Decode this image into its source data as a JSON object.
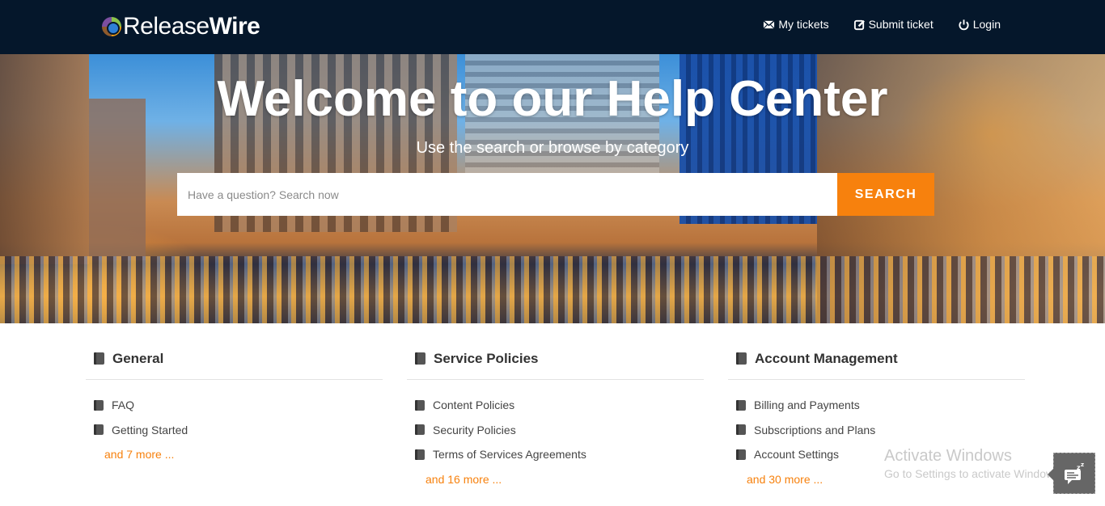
{
  "header": {
    "logo": {
      "light": "Release",
      "bold": "Wire"
    },
    "nav": [
      {
        "label": "My tickets",
        "icon": "envelope-icon"
      },
      {
        "label": "Submit ticket",
        "icon": "edit-icon"
      },
      {
        "label": "Login",
        "icon": "power-icon"
      }
    ]
  },
  "hero": {
    "title": "Welcome to our Help Center",
    "subtitle": "Use the search or browse by category",
    "search": {
      "placeholder": "Have a question? Search now",
      "value": "",
      "button_label": "SEARCH"
    }
  },
  "categories": [
    {
      "title": "General",
      "items": [
        "FAQ",
        "Getting Started"
      ],
      "more": "and 7 more ..."
    },
    {
      "title": "Service Policies",
      "items": [
        "Content Policies",
        "Security Policies",
        "Terms of Services Agreements"
      ],
      "more": "and 16 more ..."
    },
    {
      "title": "Account Management",
      "items": [
        "Billing and Payments",
        "Subscriptions and Plans",
        "Account Settings"
      ],
      "more": "and 30 more ..."
    }
  ],
  "overlay": {
    "activate_title": "Activate Windows",
    "activate_sub": "Go to Settings to activate Windows."
  },
  "colors": {
    "topbar": "#05172b",
    "accent": "#f7810d"
  }
}
